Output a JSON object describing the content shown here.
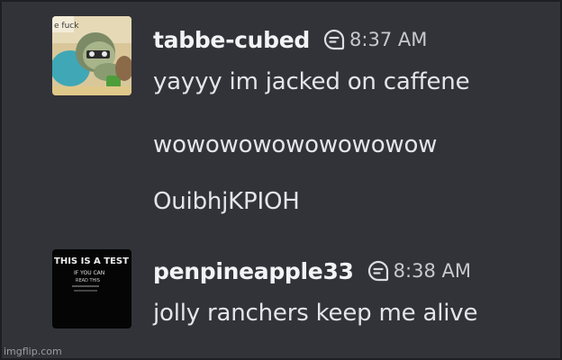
{
  "messages": [
    {
      "username": "tabbe-cubed",
      "timestamp": "8:37 AM",
      "avatar_caption": "e fuck",
      "lines": [
        "yayyy im jacked on caffene",
        "wowowowowowowowow",
        "OuibhjKPIOH"
      ]
    },
    {
      "username": "penpineapple33",
      "timestamp": "8:38 AM",
      "avatar_text": [
        "THIS IS A TEST",
        "IF YOU CAN",
        "READ THIS"
      ],
      "lines": [
        "jolly ranchers keep me alive"
      ]
    }
  ],
  "watermark": "imgflip.com",
  "icons": {
    "thread": "chat-bubble-icon"
  },
  "colors": {
    "background": "#313338",
    "username": "#f2f3f5",
    "message": "#e3e5e8",
    "timestamp": "#c7c9cc"
  }
}
